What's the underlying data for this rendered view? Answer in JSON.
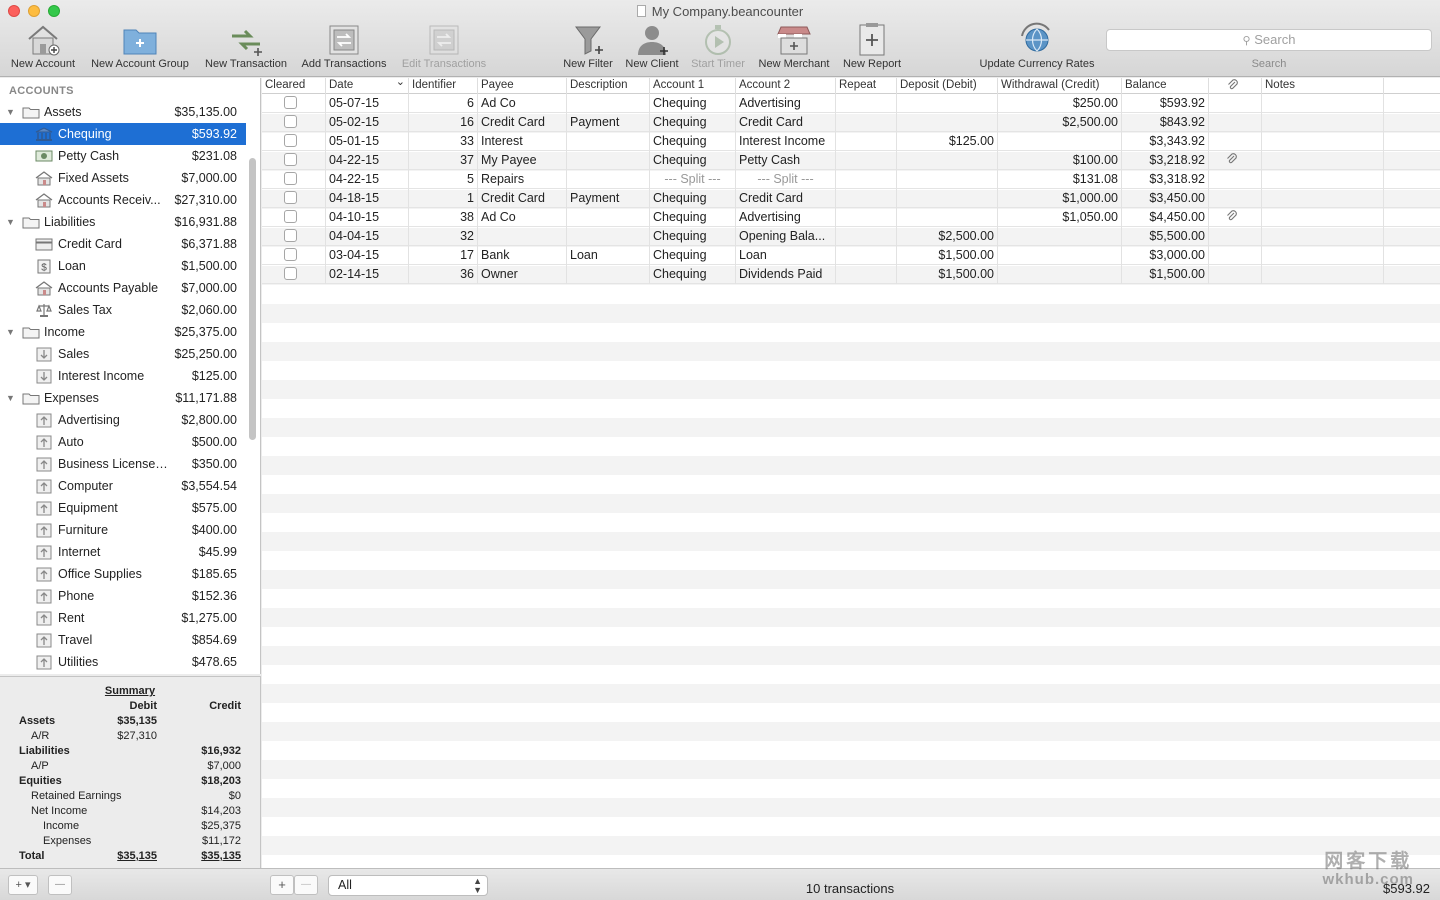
{
  "window": {
    "title": "My Company.beancounter"
  },
  "toolbar": {
    "buttons": [
      {
        "label": "New Account",
        "icon": "house-plus-icon",
        "enabled": true
      },
      {
        "label": "New Account Group",
        "icon": "folder-plus-icon",
        "enabled": true
      },
      {
        "label": "New Transaction",
        "icon": "arrows-plus-icon",
        "enabled": true
      },
      {
        "label": "Add Transactions",
        "icon": "transactions-sheet-icon",
        "enabled": true
      },
      {
        "label": "Edit Transactions",
        "icon": "transactions-sheet-icon",
        "enabled": false
      },
      {
        "label": "New Filter",
        "icon": "funnel-plus-icon",
        "enabled": true
      },
      {
        "label": "New Client",
        "icon": "person-plus-icon",
        "enabled": true
      },
      {
        "label": "Start Timer",
        "icon": "stopwatch-icon",
        "enabled": false
      },
      {
        "label": "New Merchant",
        "icon": "store-plus-icon",
        "enabled": true
      },
      {
        "label": "New Report",
        "icon": "report-plus-icon",
        "enabled": true
      },
      {
        "label": "Update Currency Rates",
        "icon": "globe-refresh-icon",
        "enabled": true
      }
    ],
    "search": {
      "placeholder": "Search",
      "label": "Search"
    }
  },
  "sidebar": {
    "header": "ACCOUNTS",
    "accounts": [
      {
        "name": "Assets",
        "balance": "$35,135.00",
        "level": 0,
        "kind": "group"
      },
      {
        "name": "Chequing",
        "balance": "$593.92",
        "level": 1,
        "kind": "bank",
        "selected": true
      },
      {
        "name": "Petty Cash",
        "balance": "$231.08",
        "level": 1,
        "kind": "cash"
      },
      {
        "name": "Fixed Assets",
        "balance": "$7,000.00",
        "level": 1,
        "kind": "house"
      },
      {
        "name": "Accounts Receiv...",
        "balance": "$27,310.00",
        "level": 1,
        "kind": "house"
      },
      {
        "name": "Liabilities",
        "balance": "$16,931.88",
        "level": 0,
        "kind": "group"
      },
      {
        "name": "Credit Card",
        "balance": "$6,371.88",
        "level": 1,
        "kind": "card"
      },
      {
        "name": "Loan",
        "balance": "$1,500.00",
        "level": 1,
        "kind": "loan"
      },
      {
        "name": "Accounts Payable",
        "balance": "$7,000.00",
        "level": 1,
        "kind": "house"
      },
      {
        "name": "Sales Tax",
        "balance": "$2,060.00",
        "level": 1,
        "kind": "scale"
      },
      {
        "name": "Income",
        "balance": "$25,375.00",
        "level": 0,
        "kind": "group"
      },
      {
        "name": "Sales",
        "balance": "$25,250.00",
        "level": 1,
        "kind": "income"
      },
      {
        "name": "Interest Income",
        "balance": "$125.00",
        "level": 1,
        "kind": "income"
      },
      {
        "name": "Expenses",
        "balance": "$11,171.88",
        "level": 0,
        "kind": "group"
      },
      {
        "name": "Advertising",
        "balance": "$2,800.00",
        "level": 1,
        "kind": "expense"
      },
      {
        "name": "Auto",
        "balance": "$500.00",
        "level": 1,
        "kind": "expense"
      },
      {
        "name": "Business Licenses/...",
        "balance": "$350.00",
        "level": 1,
        "kind": "expense"
      },
      {
        "name": "Computer",
        "balance": "$3,554.54",
        "level": 1,
        "kind": "expense"
      },
      {
        "name": "Equipment",
        "balance": "$575.00",
        "level": 1,
        "kind": "expense"
      },
      {
        "name": "Furniture",
        "balance": "$400.00",
        "level": 1,
        "kind": "expense"
      },
      {
        "name": "Internet",
        "balance": "$45.99",
        "level": 1,
        "kind": "expense"
      },
      {
        "name": "Office Supplies",
        "balance": "$185.65",
        "level": 1,
        "kind": "expense"
      },
      {
        "name": "Phone",
        "balance": "$152.36",
        "level": 1,
        "kind": "expense"
      },
      {
        "name": "Rent",
        "balance": "$1,275.00",
        "level": 1,
        "kind": "expense"
      },
      {
        "name": "Travel",
        "balance": "$854.69",
        "level": 1,
        "kind": "expense"
      },
      {
        "name": "Utilities",
        "balance": "$478.65",
        "level": 1,
        "kind": "expense"
      }
    ]
  },
  "summary": {
    "title": "Summary",
    "debit_header": "Debit",
    "credit_header": "Credit",
    "rows": [
      {
        "label": "Assets",
        "debit": "$35,135",
        "credit": "",
        "indent": 0,
        "bold": true
      },
      {
        "label": "A/R",
        "debit": "$27,310",
        "credit": "",
        "indent": 1,
        "bold": false
      },
      {
        "label": "Liabilities",
        "debit": "",
        "credit": "$16,932",
        "indent": 0,
        "bold": true
      },
      {
        "label": "A/P",
        "debit": "",
        "credit": "$7,000",
        "indent": 1,
        "bold": false
      },
      {
        "label": "Equities",
        "debit": "",
        "credit": "$18,203",
        "indent": 0,
        "bold": true
      },
      {
        "label": "Retained Earnings",
        "debit": "",
        "credit": "$0",
        "indent": 2,
        "bold": false
      },
      {
        "label": "Net Income",
        "debit": "",
        "credit": "$14,203",
        "indent": 2,
        "bold": false
      },
      {
        "label": "Income",
        "debit": "",
        "credit": "$25,375",
        "indent": 3,
        "bold": false
      },
      {
        "label": "Expenses",
        "debit": "",
        "credit": "$11,172",
        "indent": 3,
        "bold": false
      },
      {
        "label": "Total",
        "debit": "$35,135",
        "credit": "$35,135",
        "indent": 0,
        "bold": true,
        "total": true
      }
    ]
  },
  "register": {
    "columns": [
      "Cleared",
      "Date",
      "Identifier",
      "Payee",
      "Description",
      "Account 1",
      "Account 2",
      "Repeat",
      "Deposit (Debit)",
      "Withdrawal (Credit)",
      "Balance",
      "",
      "Notes"
    ],
    "rows": [
      {
        "cleared": false,
        "date": "05-07-15",
        "id": "6",
        "payee": "Ad Co",
        "desc": "",
        "acct1": "Chequing",
        "acct2": "Advertising",
        "repeat": "",
        "deposit": "",
        "withdrawal": "$250.00",
        "balance": "$593.92",
        "attach": false,
        "notes": ""
      },
      {
        "cleared": false,
        "date": "05-02-15",
        "id": "16",
        "payee": "Credit Card",
        "desc": "Payment",
        "acct1": "Chequing",
        "acct2": "Credit Card",
        "repeat": "",
        "deposit": "",
        "withdrawal": "$2,500.00",
        "balance": "$843.92",
        "attach": false,
        "notes": ""
      },
      {
        "cleared": false,
        "date": "05-01-15",
        "id": "33",
        "payee": "Interest",
        "desc": "",
        "acct1": "Chequing",
        "acct2": "Interest Income",
        "repeat": "",
        "deposit": "$125.00",
        "withdrawal": "",
        "balance": "$3,343.92",
        "attach": false,
        "notes": ""
      },
      {
        "cleared": false,
        "date": "04-22-15",
        "id": "37",
        "payee": "My Payee",
        "desc": "",
        "acct1": "Chequing",
        "acct2": "Petty Cash",
        "repeat": "",
        "deposit": "",
        "withdrawal": "$100.00",
        "balance": "$3,218.92",
        "attach": true,
        "notes": ""
      },
      {
        "cleared": false,
        "date": "04-22-15",
        "id": "5",
        "payee": "Repairs",
        "desc": "",
        "acct1": "--- Split ---",
        "acct2": "--- Split ---",
        "repeat": "",
        "deposit": "",
        "withdrawal": "$131.08",
        "balance": "$3,318.92",
        "attach": false,
        "notes": "",
        "split": true
      },
      {
        "cleared": false,
        "date": "04-18-15",
        "id": "1",
        "payee": "Credit Card",
        "desc": "Payment",
        "acct1": "Chequing",
        "acct2": "Credit Card",
        "repeat": "",
        "deposit": "",
        "withdrawal": "$1,000.00",
        "balance": "$3,450.00",
        "attach": false,
        "notes": ""
      },
      {
        "cleared": false,
        "date": "04-10-15",
        "id": "38",
        "payee": "Ad Co",
        "desc": "",
        "acct1": "Chequing",
        "acct2": "Advertising",
        "repeat": "",
        "deposit": "",
        "withdrawal": "$1,050.00",
        "balance": "$4,450.00",
        "attach": true,
        "notes": ""
      },
      {
        "cleared": false,
        "date": "04-04-15",
        "id": "32",
        "payee": "",
        "desc": "",
        "acct1": "Chequing",
        "acct2": "Opening Bala...",
        "repeat": "",
        "deposit": "$2,500.00",
        "withdrawal": "",
        "balance": "$5,500.00",
        "attach": false,
        "notes": ""
      },
      {
        "cleared": false,
        "date": "03-04-15",
        "id": "17",
        "payee": "Bank",
        "desc": "Loan",
        "acct1": "Chequing",
        "acct2": "Loan",
        "repeat": "",
        "deposit": "$1,500.00",
        "withdrawal": "",
        "balance": "$3,000.00",
        "attach": false,
        "notes": ""
      },
      {
        "cleared": false,
        "date": "02-14-15",
        "id": "36",
        "payee": "Owner",
        "desc": "",
        "acct1": "Chequing",
        "acct2": "Dividends Paid",
        "repeat": "",
        "deposit": "$1,500.00",
        "withdrawal": "",
        "balance": "$1,500.00",
        "attach": false,
        "notes": ""
      }
    ]
  },
  "bottom": {
    "add_label": "+",
    "add_menu_label": "+ ▾",
    "remove_label": "—",
    "filter_value": "All",
    "transaction_count": "10 transactions",
    "total_balance": "$593.92"
  },
  "watermark": {
    "line1": "网客下载",
    "line2": "wkhub.com"
  },
  "colors": {
    "selection": "#1e6fd4",
    "stripe": "#f3f3f3"
  }
}
